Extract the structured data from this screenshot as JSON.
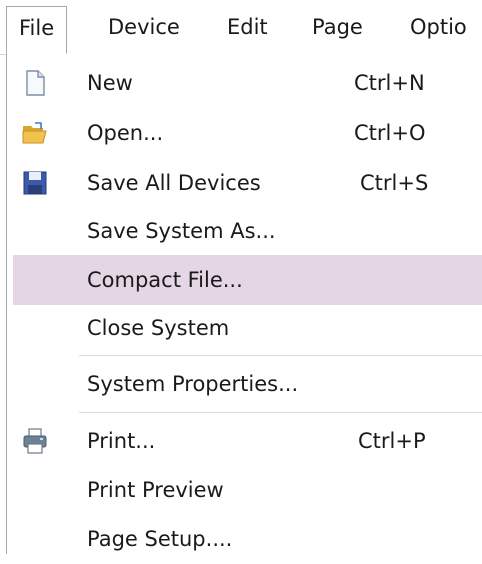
{
  "menubar": {
    "items": [
      {
        "label": "File",
        "active": true
      },
      {
        "label": "Device"
      },
      {
        "label": "Edit"
      },
      {
        "label": "Page"
      },
      {
        "label": "Optio"
      }
    ]
  },
  "file_menu": {
    "items": [
      {
        "label": "New",
        "shortcut": "Ctrl+N",
        "icon": "new-document-icon"
      },
      {
        "label": "Open...",
        "shortcut": "Ctrl+O",
        "icon": "open-folder-icon"
      },
      {
        "label": "Save All Devices",
        "shortcut": "Ctrl+S",
        "icon": "save-disk-icon"
      },
      {
        "label": "Save System As..."
      },
      {
        "label": "Compact File...",
        "highlighted": true
      },
      {
        "label": "Close System"
      },
      {
        "label": "System Properties..."
      },
      {
        "label": "Print...",
        "shortcut": "Ctrl+P",
        "icon": "printer-icon"
      },
      {
        "label": "Print Preview"
      },
      {
        "label": "Page Setup...."
      }
    ]
  },
  "colors": {
    "highlight": "#e4d6e4",
    "border": "#a8a8a8",
    "separator": "#dcdcdc"
  }
}
